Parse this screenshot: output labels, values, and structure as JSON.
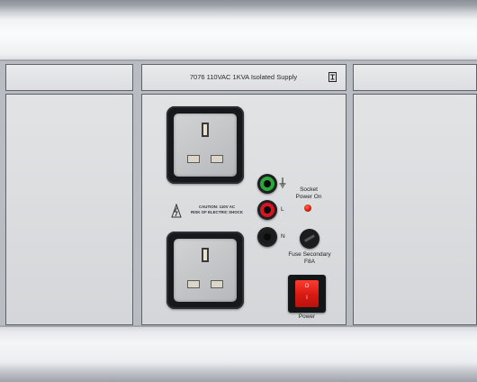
{
  "panel": {
    "title": "7076 110VAC 1KVA Isolated Supply",
    "caution_line1": "CAUTION: 110V AC",
    "caution_line2": "RISK OF ELECTRIC SHOCK"
  },
  "terminals": {
    "live_label": "L",
    "neutral_label": "N"
  },
  "indicator": {
    "line1": "Socket",
    "line2": "Power On"
  },
  "fuse": {
    "line1": "Fuse Secondary",
    "line2": "F8A"
  },
  "power_switch": {
    "on_mark": "O",
    "off_mark": "I",
    "label": "Power"
  },
  "colors": {
    "earth_terminal": "#2aa83a",
    "live_terminal": "#d8141e",
    "neutral_terminal": "#1c1c1c",
    "switch_rocker": "#e0231a",
    "led": "#e0231a"
  },
  "icons": [
    "ce-mark-icon",
    "earth-symbol-icon",
    "electric-shock-warning-icon"
  ]
}
